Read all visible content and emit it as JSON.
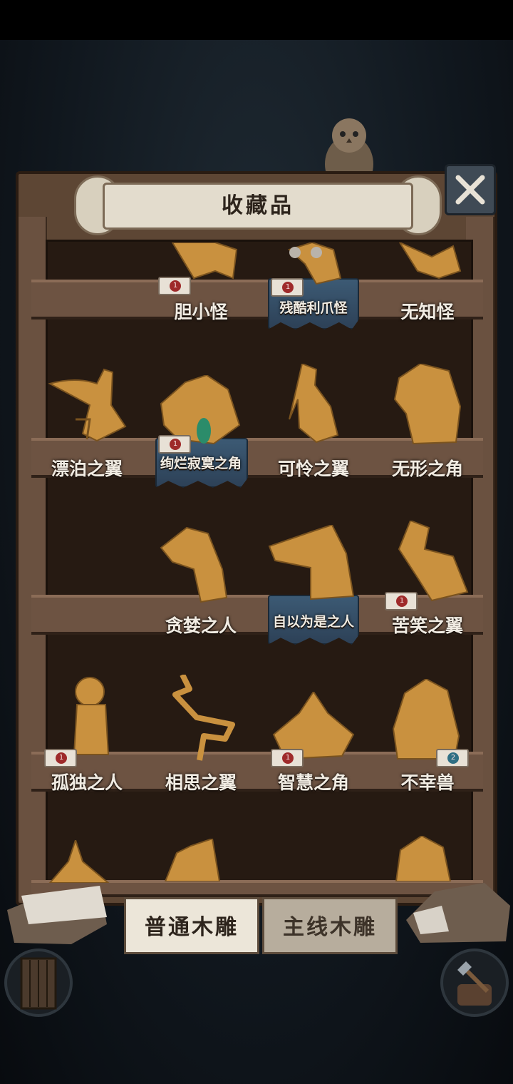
{
  "title": "收藏品",
  "tabs": [
    {
      "label": "普通木雕",
      "active": true
    },
    {
      "label": "主线木雕",
      "active": false
    }
  ],
  "shelves": [
    {
      "items": [
        {
          "name": "",
          "icon": "empty-slot"
        },
        {
          "name": "胆小怪",
          "icon": "shy-creature-carving",
          "badge": "1",
          "badge_color": "red"
        },
        {
          "name": "残酷利爪怪",
          "icon": "cruel-claw-carving",
          "badge": "1",
          "badge_color": "red",
          "highlight": true
        },
        {
          "name": "无知怪",
          "icon": "ignorant-creature-carving"
        }
      ]
    },
    {
      "items": [
        {
          "name": "漂泊之翼",
          "icon": "wandering-wing-carving"
        },
        {
          "name": "绚烂寂寞之角",
          "icon": "brilliant-lonely-horn-carving",
          "badge": "1",
          "badge_color": "red",
          "highlight": true
        },
        {
          "name": "可怜之翼",
          "icon": "pitiful-wing-carving"
        },
        {
          "name": "无形之角",
          "icon": "formless-horn-carving"
        }
      ]
    },
    {
      "items": [
        {
          "name": "",
          "icon": "empty-slot"
        },
        {
          "name": "贪婪之人",
          "icon": "greedy-person-carving"
        },
        {
          "name": "自以为是之人",
          "icon": "self-righteous-person-carving",
          "highlight": true
        },
        {
          "name": "苦笑之翼",
          "icon": "bitter-smile-wing-carving",
          "badge": "1",
          "badge_color": "red"
        }
      ]
    },
    {
      "items": [
        {
          "name": "孤独之人",
          "icon": "lonely-person-carving",
          "badge": "1",
          "badge_color": "red"
        },
        {
          "name": "相思之翼",
          "icon": "lovesick-wing-carving"
        },
        {
          "name": "智慧之角",
          "icon": "wise-horn-carving",
          "badge": "1",
          "badge_color": "red"
        },
        {
          "name": "不幸兽",
          "icon": "unlucky-beast-carving",
          "badge": "2",
          "badge_color": "blue"
        }
      ]
    }
  ],
  "colors": {
    "wood": "#5d4634",
    "carving": "#c9913f",
    "plate_highlight": "#3c5a74",
    "text": "#f1ece3"
  }
}
